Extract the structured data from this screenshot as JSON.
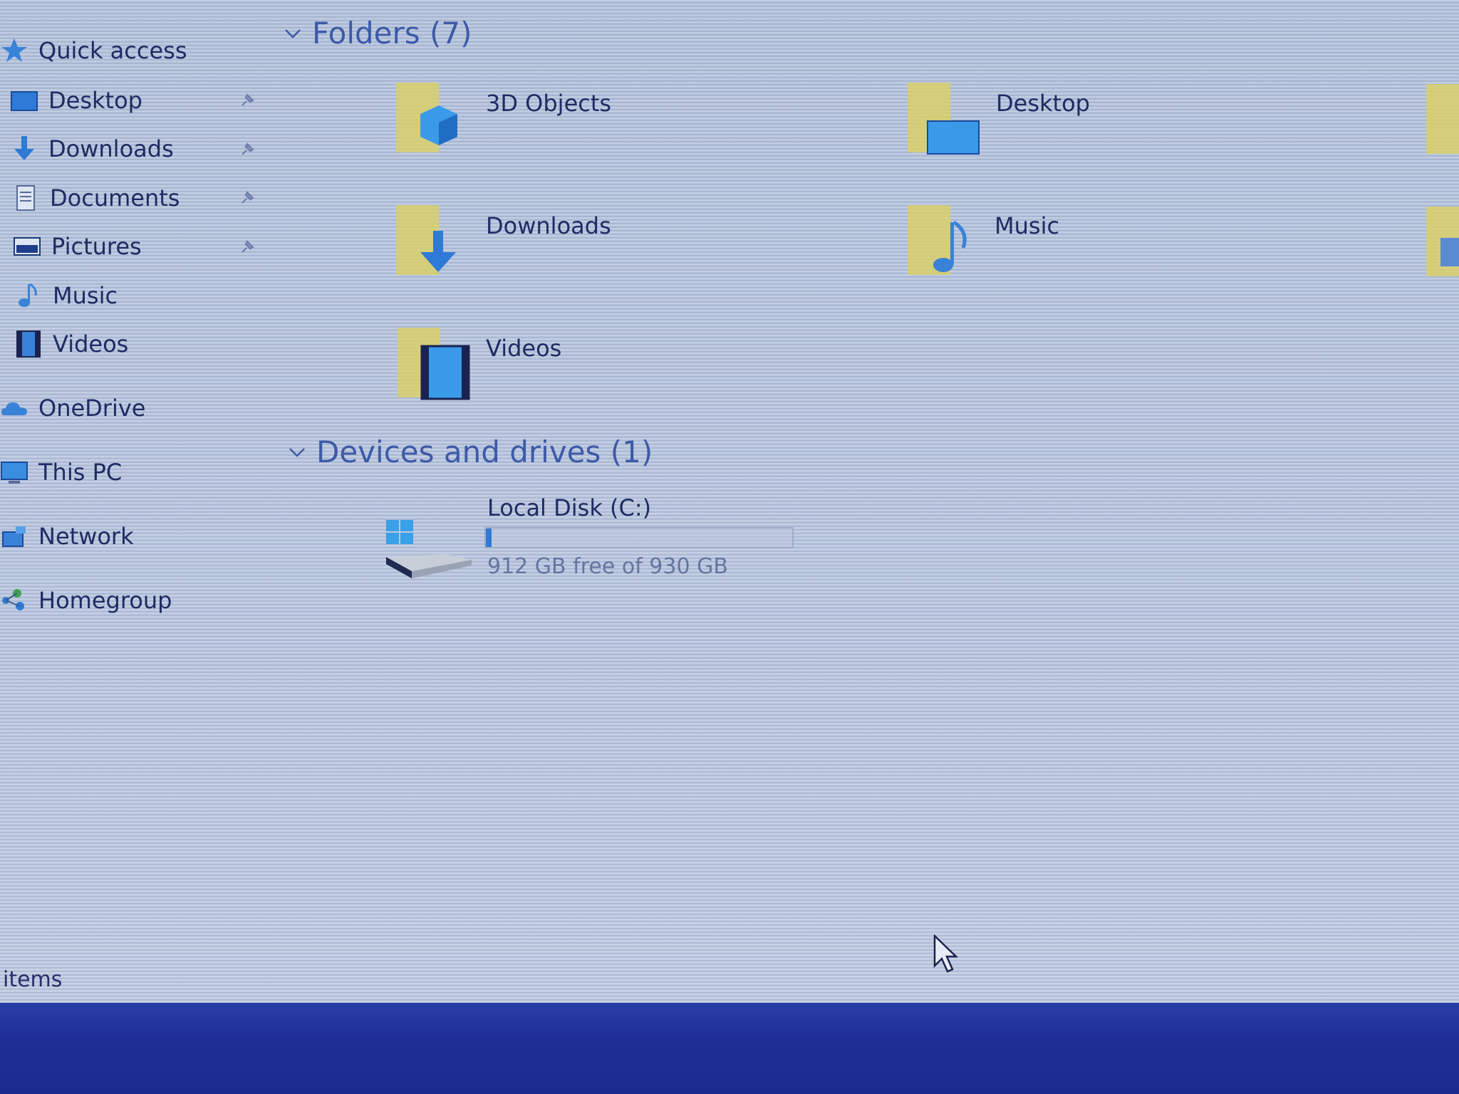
{
  "nav": {
    "quick_access": "Quick access",
    "items": [
      {
        "label": "Desktop",
        "icon": "desktop-icon",
        "pinned": true
      },
      {
        "label": "Downloads",
        "icon": "downloads-icon",
        "pinned": true
      },
      {
        "label": "Documents",
        "icon": "documents-icon",
        "pinned": true
      },
      {
        "label": "Pictures",
        "icon": "pictures-icon",
        "pinned": true
      },
      {
        "label": "Music",
        "icon": "music-icon",
        "pinned": false
      },
      {
        "label": "Videos",
        "icon": "videos-icon",
        "pinned": false
      }
    ],
    "onedrive": "OneDrive",
    "this_pc": "This PC",
    "network": "Network",
    "homegroup": "Homegroup"
  },
  "content": {
    "folders_header": "Folders (7)",
    "folders": [
      {
        "label": "3D Objects",
        "icon": "3d-objects-icon"
      },
      {
        "label": "Desktop",
        "icon": "desktop-folder-icon"
      },
      {
        "label": "Downloads",
        "icon": "downloads-folder-icon"
      },
      {
        "label": "Music",
        "icon": "music-folder-icon"
      },
      {
        "label": "Videos",
        "icon": "videos-folder-icon"
      }
    ],
    "devices_header": "Devices and drives (1)",
    "drive": {
      "label": "Local Disk (C:)",
      "free_text": "912 GB free of 930 GB",
      "used_fraction": 0.019
    }
  },
  "status": {
    "items_text": "items"
  },
  "colors": {
    "accent": "#2e7ad6",
    "folder_yellow": "#d9cf6a",
    "taskbar": "#1d2f96"
  }
}
